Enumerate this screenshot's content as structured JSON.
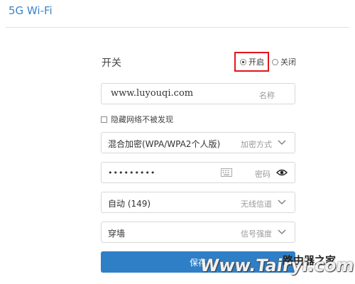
{
  "header": {
    "title": "5G Wi-Fi"
  },
  "switch": {
    "label": "开关",
    "on_label": "开启",
    "off_label": "关闭",
    "selected": "on"
  },
  "ssid": {
    "value": "www.luyouqi.com",
    "hint": "名称"
  },
  "hide_ssid": {
    "label": "隐藏网络不被发现",
    "checked": false
  },
  "encryption": {
    "value": "混合加密(WPA/WPA2个人版)",
    "hint": "加密方式"
  },
  "password": {
    "value": "•••••••••",
    "hint": "密码"
  },
  "channel": {
    "value": "自动 (149)",
    "hint": "无线信道"
  },
  "signal": {
    "value": "穿墙",
    "hint": "信号强度"
  },
  "save": {
    "label": "保存"
  },
  "watermark": {
    "text": "Www.Tairyi.com",
    "top_text": "路由器之家"
  },
  "colors": {
    "accent": "#3a84c9",
    "button": "#2f7fc6",
    "highlight": "#e0161c"
  }
}
